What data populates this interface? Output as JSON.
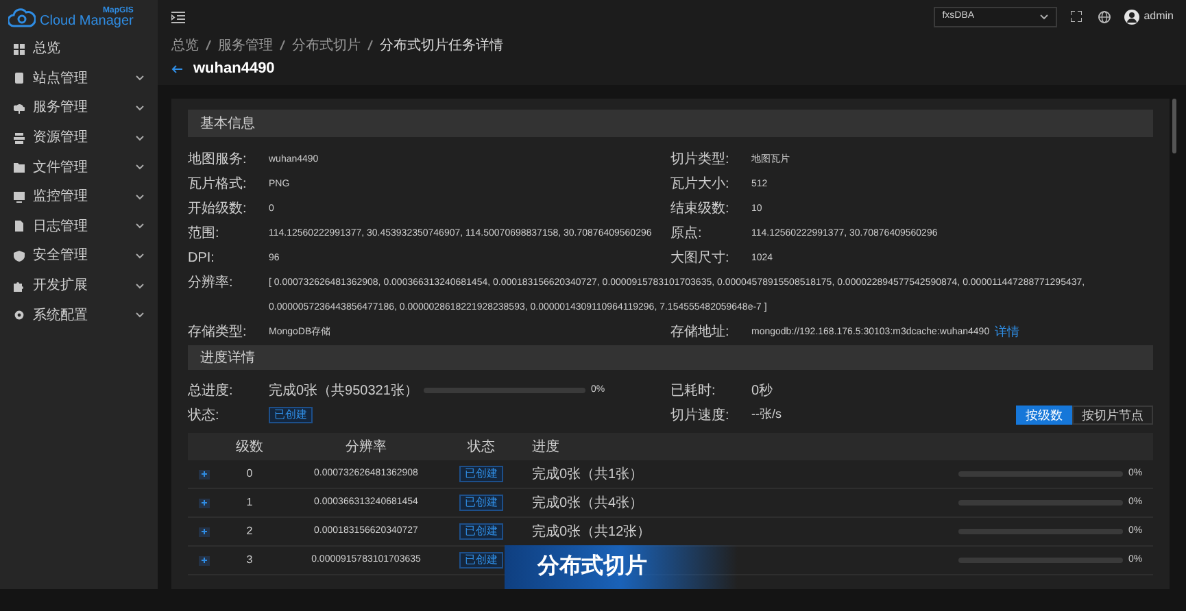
{
  "brand": {
    "small": "MapGIS",
    "name": "Cloud Manager"
  },
  "sidebar": {
    "items": [
      {
        "label": "总览",
        "expandable": false
      },
      {
        "label": "站点管理",
        "expandable": true
      },
      {
        "label": "服务管理",
        "expandable": true
      },
      {
        "label": "资源管理",
        "expandable": true
      },
      {
        "label": "文件管理",
        "expandable": true
      },
      {
        "label": "监控管理",
        "expandable": true
      },
      {
        "label": "日志管理",
        "expandable": true
      },
      {
        "label": "安全管理",
        "expandable": true
      },
      {
        "label": "开发扩展",
        "expandable": true
      },
      {
        "label": "系统配置",
        "expandable": true
      }
    ]
  },
  "header": {
    "site_select": "fxsDBA",
    "user": "admin"
  },
  "breadcrumb": [
    "总览",
    "服务管理",
    "分布式切片",
    "分布式切片任务详情"
  ],
  "title": "wuhan4490",
  "basic_info": {
    "title": "基本信息",
    "rows": [
      {
        "left": {
          "label": "地图服务:",
          "value": "wuhan4490"
        },
        "right": {
          "label": "切片类型:",
          "value": "地图瓦片"
        }
      },
      {
        "left": {
          "label": "瓦片格式:",
          "value": "PNG"
        },
        "right": {
          "label": "瓦片大小:",
          "value": "512"
        }
      },
      {
        "left": {
          "label": "开始级数:",
          "value": "0"
        },
        "right": {
          "label": "结束级数:",
          "value": "10"
        }
      },
      {
        "left": {
          "label": "范围:",
          "value": "114.12560222991377, 30.453932350746907, 114.50070698837158, 30.70876409560296"
        },
        "right": {
          "label": "原点:",
          "value": "114.12560222991377, 30.70876409560296"
        }
      },
      {
        "left": {
          "label": "DPI:",
          "value": "96"
        },
        "right": {
          "label": "大图尺寸:",
          "value": "1024"
        }
      },
      {
        "left": {
          "label": "分辨率:",
          "value": "[ 0.000732626481362908, 0.000366313240681454, 0.000183156620340727, 0.0000915783101703635, 0.0000457891550851​8175, 0.000022894577542590874, 0.000011447288771295437,",
          "value2": "0.0000057236443856477186, 0.0000028618221928238593, 0.0000014309110964119296, 7.154555482059648e-7 ]"
        }
      },
      {
        "left": {
          "label": "存储类型:",
          "value": "MongoDB存储"
        },
        "right": {
          "label": "存储地址:",
          "value": "mongodb://192.168.176.5:30103:m3dcache:wuhan4490",
          "link": "详情"
        }
      }
    ]
  },
  "progress": {
    "title": "进度详情",
    "total": {
      "label": "总进度:",
      "text": "完成0张（共950321张）",
      "level": 0,
      "percent": "0%"
    },
    "status": {
      "label": "状态:",
      "tag": "已创建"
    },
    "elapsed": {
      "label": "已耗时:",
      "value": "0秒"
    },
    "speed": {
      "label": "切片速度:",
      "value": "--张/s"
    },
    "toggle": [
      {
        "label": "按级数",
        "selected": true
      },
      {
        "label": "按切片节点",
        "selected": false
      }
    ]
  },
  "table": {
    "columns": [
      "级数",
      "分辨率",
      "状态",
      "进度"
    ],
    "rows": [
      {
        "level_no": "0",
        "resolution": "0.000732626481362908",
        "status": "已创建",
        "progress": "完成0张（共1张）",
        "level": 0,
        "percent": "0%"
      },
      {
        "level_no": "1",
        "resolution": "0.000366313240681454",
        "status": "已创建",
        "progress": "完成0张（共4张）",
        "level": 0,
        "percent": "0%"
      },
      {
        "level_no": "2",
        "resolution": "0.000183156620340727",
        "status": "已创建",
        "progress": "完成0张（共12张）",
        "level": 0,
        "percent": "0%"
      },
      {
        "level_no": "3",
        "resolution": "0.0000915783101703635",
        "status": "已创建",
        "level": 0,
        "percent": "0%"
      }
    ]
  },
  "caption": "分布式切片"
}
